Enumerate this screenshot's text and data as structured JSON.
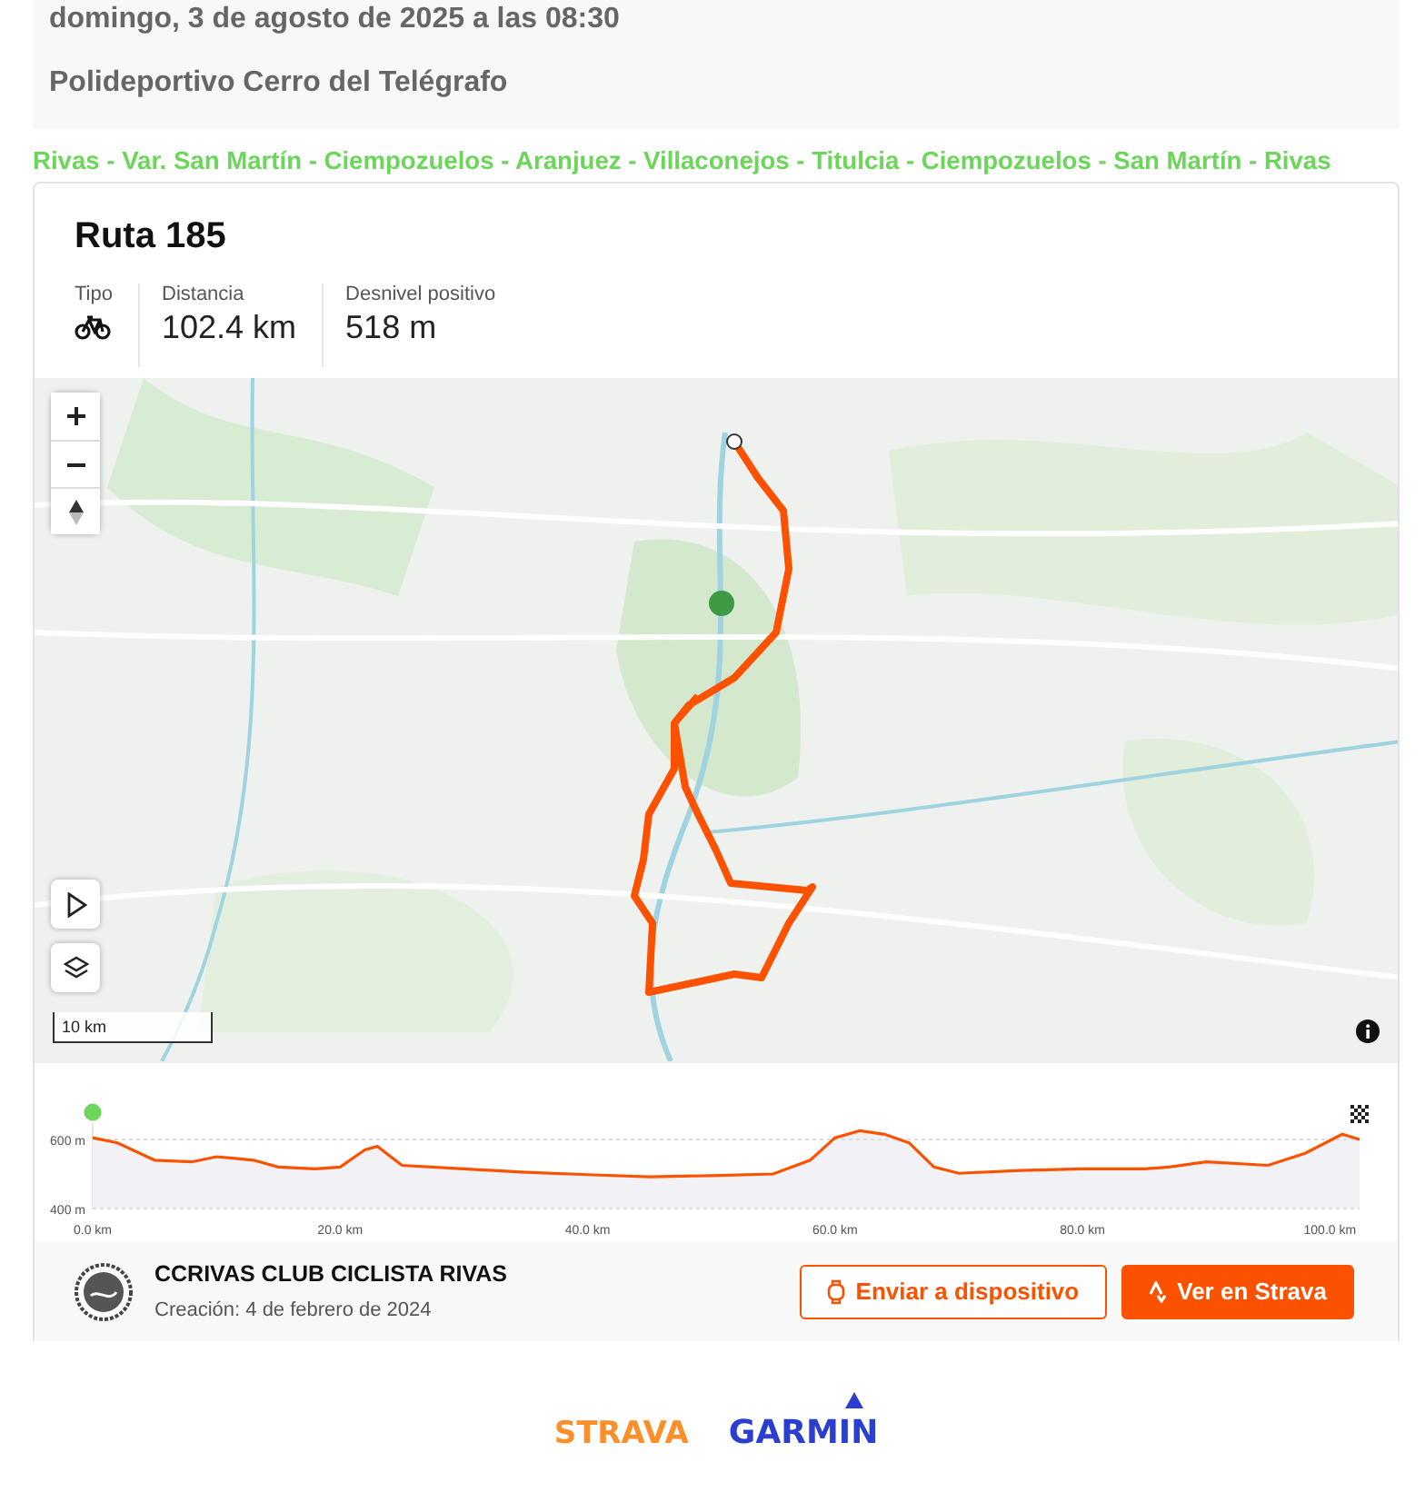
{
  "event": {
    "date": "domingo, 3 de agosto de 2025 a las 08:30",
    "place": "Polideportivo Cerro del Telégrafo"
  },
  "route_name": "Rivas - Var. San Martín - Ciempozuelos - Aranjuez - Villaconejos - Titulcia - Ciempozuelos - San Martín - Rivas",
  "route": {
    "title": "Ruta 185",
    "stats": [
      {
        "kind": "icon",
        "label": "Tipo"
      },
      {
        "kind": "text",
        "label": "Distancia",
        "value": "102.4 km"
      },
      {
        "kind": "text",
        "label": "Desnivel positivo",
        "value": "518 m"
      }
    ],
    "map": {
      "scale": "10 km"
    },
    "elevation": {
      "chart_data": {
        "type": "area",
        "x": [
          0,
          2,
          5,
          8,
          10,
          13,
          15,
          18,
          20,
          22,
          23,
          25,
          30,
          35,
          40,
          45,
          50,
          55,
          58,
          60,
          62,
          64,
          66,
          68,
          70,
          75,
          80,
          85,
          87,
          90,
          95,
          98,
          101,
          102.4
        ],
        "series": [
          {
            "color": "#fc5200",
            "values": [
              605,
              590,
              540,
              535,
              550,
              540,
              520,
              515,
              520,
              570,
              580,
              525,
              515,
              505,
              498,
              492,
              495,
              500,
              540,
              605,
              625,
              615,
              590,
              520,
              502,
              510,
              515,
              515,
              520,
              535,
              525,
              560,
              615,
              600
            ]
          }
        ],
        "xlim": [
          0,
          102.4
        ],
        "ylim": [
          400,
          650
        ],
        "xticks": [
          {
            "value": 0,
            "label": "0.0 km"
          },
          {
            "value": 20,
            "label": "20.0 km"
          },
          {
            "value": 40,
            "label": "40.0 km"
          },
          {
            "value": 60,
            "label": "60.0 km"
          },
          {
            "value": 80,
            "label": "80.0 km"
          },
          {
            "value": 100,
            "label": "100.0 km"
          }
        ],
        "yticks": [
          {
            "value": 400,
            "label": "400 m"
          },
          {
            "value": 600,
            "label": "600 m"
          }
        ]
      }
    },
    "owner": {
      "name": "CCRIVAS CLUB CICLISTA RIVAS",
      "created_label": "Creación:",
      "created": "4 de febrero de 2024"
    },
    "buttons": [
      {
        "kind": "outline",
        "label": "Enviar a dispositivo"
      },
      {
        "kind": "primary",
        "label": "Ver en Strava"
      }
    ]
  },
  "partners": [
    {
      "kind": "strava",
      "label": "STRAVA"
    },
    {
      "kind": "garmin",
      "label": "GARMIN"
    }
  ]
}
